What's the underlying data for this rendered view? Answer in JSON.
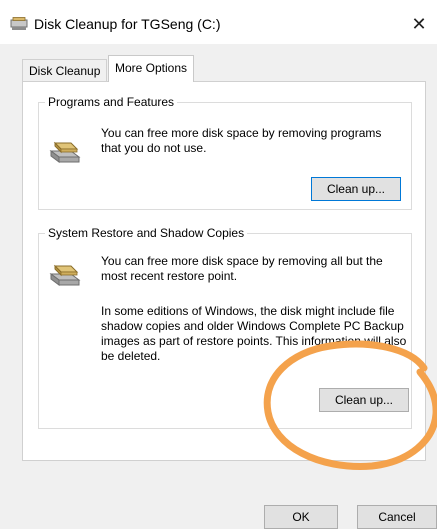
{
  "window": {
    "title": "Disk Cleanup for TGSeng (C:)",
    "close_symbol": "✕"
  },
  "tabs": [
    {
      "label": "Disk Cleanup",
      "active": false
    },
    {
      "label": "More Options",
      "active": true
    }
  ],
  "programs_features": {
    "title": "Programs and Features",
    "description": "You can free more disk space by removing programs that you do not use.",
    "button_label": "Clean up...",
    "icon": "disk-drive-icon"
  },
  "system_restore": {
    "title": "System Restore and Shadow Copies",
    "description": "You can free more disk space by removing all but the most recent restore point.",
    "details": "In some editions of Windows, the disk might include file shadow copies and older Windows Complete PC Backup images as part of restore points. This information will also be deleted.",
    "button_label": "Clean up...",
    "icon": "disk-drive-icon"
  },
  "footer": {
    "ok_label": "OK",
    "cancel_label": "Cancel"
  },
  "colors": {
    "annotation_circle": "#f4a24c",
    "focus_border": "#0078d7"
  }
}
